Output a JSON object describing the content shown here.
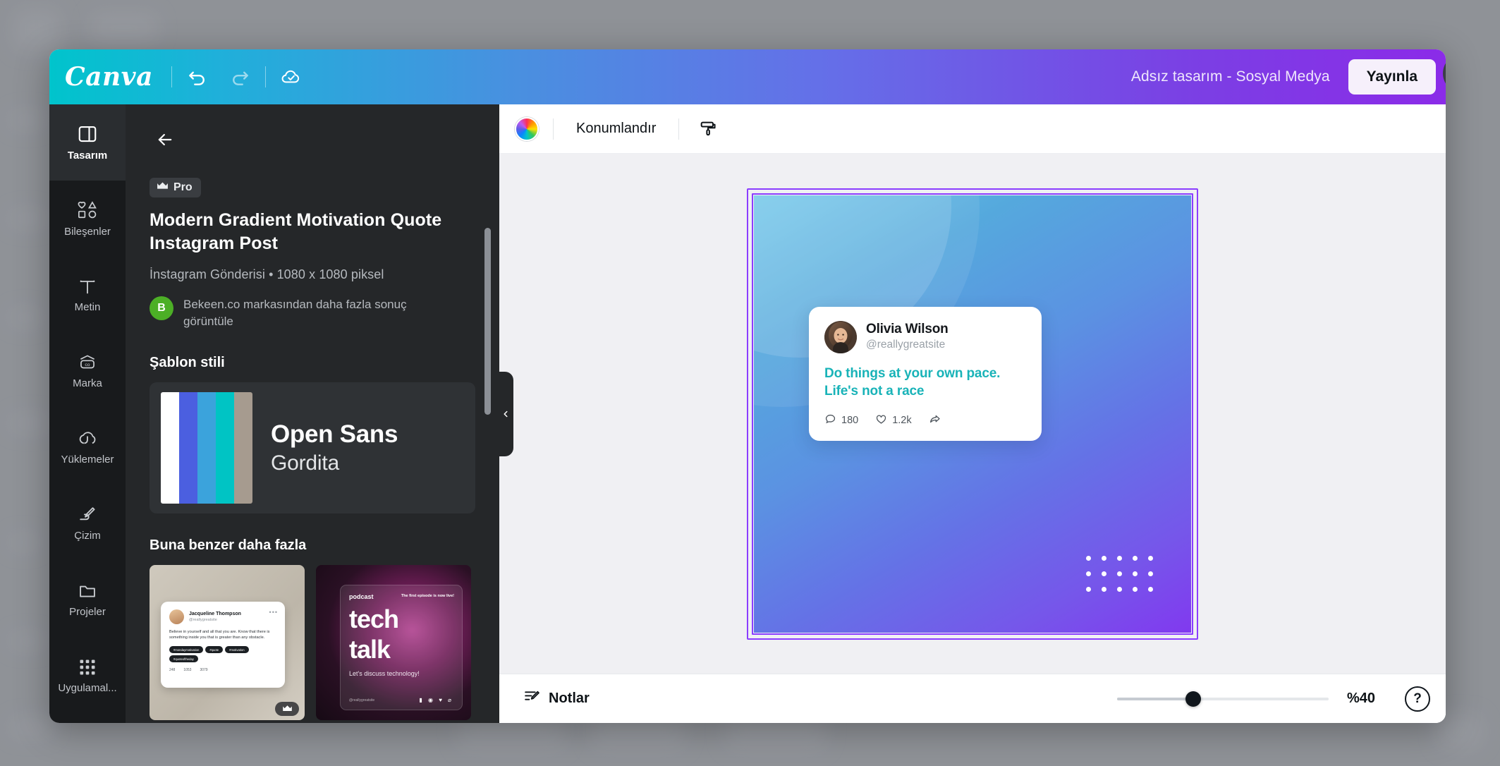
{
  "app": {
    "logo_text": "Canva",
    "document_title": "Adsız tasarım - Sosyal Medya",
    "publish_label": "Yayınla",
    "close_label": "✕",
    "accent_teal": "#00c4cc",
    "accent_purple": "#8b3dff"
  },
  "header_icons": [
    {
      "name": "undo-icon",
      "label": "Geri al"
    },
    {
      "name": "redo-icon",
      "label": "Yinele"
    },
    {
      "name": "cloud-saved-icon",
      "label": "Kaydedildi"
    }
  ],
  "rail": {
    "items": [
      {
        "label": "Tasarım",
        "icon": "design-icon",
        "active": true
      },
      {
        "label": "Bileşenler",
        "icon": "elements-icon",
        "active": false
      },
      {
        "label": "Metin",
        "icon": "text-icon",
        "active": false
      },
      {
        "label": "Marka",
        "icon": "brand-icon",
        "active": false
      },
      {
        "label": "Yüklemeler",
        "icon": "uploads-icon",
        "active": false
      },
      {
        "label": "Çizim",
        "icon": "draw-icon",
        "active": false
      },
      {
        "label": "Projeler",
        "icon": "projects-icon",
        "active": false
      },
      {
        "label": "Uygulamal...",
        "icon": "apps-icon",
        "active": false
      }
    ]
  },
  "panel": {
    "back_label": "←",
    "pro_badge": "Pro",
    "crown_icon": "crown-icon",
    "template_title": "Modern Gradient Motivation Quote Instagram Post",
    "template_meta": "İnstagram Gönderisi • 1080 x 1080 piksel",
    "brand_initial": "B",
    "brand_text": "Bekeen.co markasından daha fazla sonuç görüntüle",
    "style_section_title": "Şablon stili",
    "style_swatches": [
      "#ffffff",
      "#4b5fe0",
      "#3ba3dc",
      "#00c4c4",
      "#a69b8f"
    ],
    "font_primary": "Open Sans",
    "font_secondary": "Gordita",
    "similar_section_title": "Buna benzer daha fazla",
    "thumbnails": [
      {
        "name": "Jacqueline Thompson",
        "handle": "@reallygreatsite",
        "body": "Believe in yourself and all that you are. Know that there is something inside you that is greater than any obstacle.",
        "tags": [
          "#mondaymotivation",
          "#quote",
          "#motivation",
          "#quoteoftheday"
        ],
        "comments": "248",
        "retweets": "1053",
        "likes": "3079",
        "more_icon": "more-dots-icon",
        "pro_icon": "crown-icon"
      },
      {
        "kicker": "podcast",
        "episode_note": "The first episode is now live!",
        "title_line1": "tech",
        "title_line2": "talk",
        "subtitle": "Let's discuss technology!",
        "handle": "@reallygreatsite",
        "social_icons": "▮ ◉ ♥ ⌀"
      }
    ]
  },
  "toolbar": {
    "color_wheel_icon": "color-wheel-icon",
    "position_label": "Konumlandır",
    "paint_roller_icon": "paint-roller-icon"
  },
  "design": {
    "author_name": "Olivia Wilson",
    "author_handle": "@reallygreatsite",
    "quote_line1": "Do things at your own pace.",
    "quote_line2": "Life's not a race",
    "quote_color": "#19b3b8",
    "comment_count": "180",
    "like_count": "1.2k",
    "share_icon": "share-icon",
    "comment_icon": "comment-icon",
    "heart_icon": "heart-icon",
    "dot_grid_rows": 3,
    "dot_grid_cols": 5
  },
  "bottom": {
    "notes_label": "Notlar",
    "notes_icon": "notes-pencil-icon",
    "zoom_label": "%40",
    "zoom_percent": 36,
    "help_label": "?"
  }
}
